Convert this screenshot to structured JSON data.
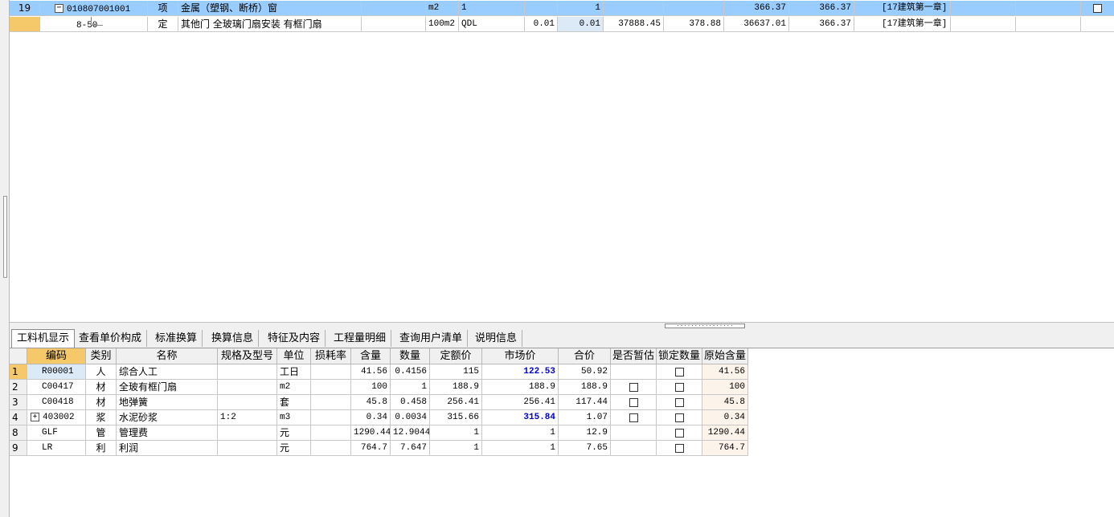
{
  "top_rows": [
    {
      "row_no": "19",
      "code": "010807001001",
      "type": "项",
      "name": "金属（塑钢、断桥）窗",
      "spec": "",
      "unit": "m2",
      "expr": "1",
      "content": "",
      "qty": "1",
      "unit_price": "",
      "total1": "",
      "total2": "366.37",
      "comp_price": "366.37",
      "chapter": "[17建筑第一章]",
      "expand": "−"
    },
    {
      "row_no": "",
      "code": "8-50",
      "type": "定",
      "name": "其他门 全玻璃门扇安装 有框门扇",
      "spec": "",
      "unit": "100m2",
      "expr": "QDL",
      "content": "0.01",
      "qty": "0.01",
      "unit_price": "37888.45",
      "total1": "378.88",
      "total2": "36637.01",
      "comp_price": "366.37",
      "chapter": "[17建筑第一章]"
    }
  ],
  "tabs": [
    "工料机显示",
    "查看单价构成",
    "标准换算",
    "换算信息",
    "特征及内容",
    "工程量明细",
    "查询用户清单",
    "说明信息"
  ],
  "columns": [
    "编码",
    "类别",
    "名称",
    "规格及型号",
    "单位",
    "损耗率",
    "含量",
    "数量",
    "定额价",
    "市场价",
    "合价",
    "是否暂估",
    "锁定数量",
    "原始含量"
  ],
  "materials": [
    {
      "no": "1",
      "code": "R00001",
      "cat": "人",
      "name": "综合人工",
      "spec": "",
      "unit": "工日",
      "loss": "",
      "content": "41.56",
      "qty": "0.4156",
      "quota": "115",
      "market": "122.53",
      "total": "50.92",
      "orig": "41.56",
      "market_highlight": true,
      "est_box": false
    },
    {
      "no": "2",
      "code": "C00417",
      "cat": "材",
      "name": "全玻有框门扇",
      "spec": "",
      "unit": "m2",
      "loss": "",
      "content": "100",
      "qty": "1",
      "quota": "188.9",
      "market": "188.9",
      "total": "188.9",
      "orig": "100",
      "market_highlight": false,
      "est_box": true
    },
    {
      "no": "3",
      "code": "C00418",
      "cat": "材",
      "name": "地弹簧",
      "spec": "",
      "unit": "套",
      "loss": "",
      "content": "45.8",
      "qty": "0.458",
      "quota": "256.41",
      "market": "256.41",
      "total": "117.44",
      "orig": "45.8",
      "market_highlight": false,
      "est_box": true
    },
    {
      "no": "4",
      "code": "403002",
      "cat": "浆",
      "name": "水泥砂浆",
      "spec": "1:2",
      "unit": "m3",
      "loss": "",
      "content": "0.34",
      "qty": "0.0034",
      "quota": "315.66",
      "market": "315.84",
      "total": "1.07",
      "orig": "0.34",
      "market_highlight": true,
      "est_box": true,
      "expand": "+"
    },
    {
      "no": "8",
      "code": "GLF",
      "cat": "管",
      "name": "管理费",
      "spec": "",
      "unit": "元",
      "loss": "",
      "content": "1290.44",
      "qty": "12.9044",
      "quota": "1",
      "market": "1",
      "total": "12.9",
      "orig": "1290.44",
      "market_highlight": false,
      "est_box": false
    },
    {
      "no": "9",
      "code": "LR",
      "cat": "利",
      "name": "利润",
      "spec": "",
      "unit": "元",
      "loss": "",
      "content": "764.7",
      "qty": "7.647",
      "quota": "1",
      "market": "1",
      "total": "7.65",
      "orig": "764.7",
      "market_highlight": false,
      "est_box": false
    }
  ],
  "colors": {
    "selected_row": "#99ccff",
    "header_selected": "#f5c96a",
    "market_highlight": "#0000cc",
    "orig_bg": "#fcf3ea"
  }
}
